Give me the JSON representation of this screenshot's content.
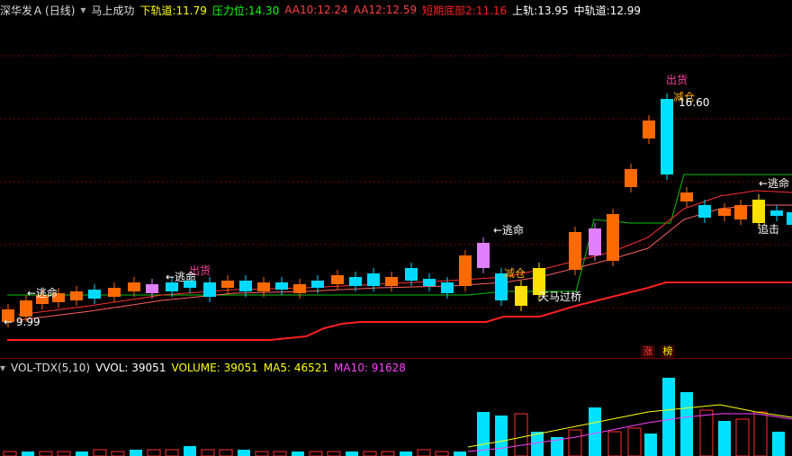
{
  "header": {
    "stock": "深华发Ａ",
    "period": "(日线)",
    "indicator": "马上成功",
    "items": [
      {
        "label": "下轨道:",
        "value": "11.79",
        "color": "#ffff00"
      },
      {
        "label": "压力位:",
        "value": "14.30",
        "color": "#00ff00"
      },
      {
        "label": "AA10:",
        "value": "12.24",
        "color": "#ff4040"
      },
      {
        "label": "AA12:",
        "value": "12.59",
        "color": "#ff4040"
      },
      {
        "label": "短期底部2:",
        "value": "11.16",
        "color": "#ff2020"
      },
      {
        "label": "上轨:",
        "value": "13.95",
        "color": "#ffffff"
      },
      {
        "label": "中轨道:",
        "value": "12.99",
        "color": "#ffffff"
      }
    ]
  },
  "annotations": {
    "escape": "←逃命",
    "sell": "出货",
    "reduce": "减仓",
    "chase": "追击",
    "tianma": "天马过桥",
    "high_price": "16.60",
    "low_price": "9.99"
  },
  "badges": [
    "涨",
    "榜"
  ],
  "volume": {
    "title": "VOL-TDX(5,10)",
    "items": [
      {
        "label": "VVOL:",
        "value": "39051",
        "color": "#ffffff"
      },
      {
        "label": "VOLUME:",
        "value": "39051",
        "color": "#ffff00"
      },
      {
        "label": "MA5:",
        "value": "46521",
        "color": "#ffff00"
      },
      {
        "label": "MA10:",
        "value": "91628",
        "color": "#ff40ff"
      }
    ]
  }
}
